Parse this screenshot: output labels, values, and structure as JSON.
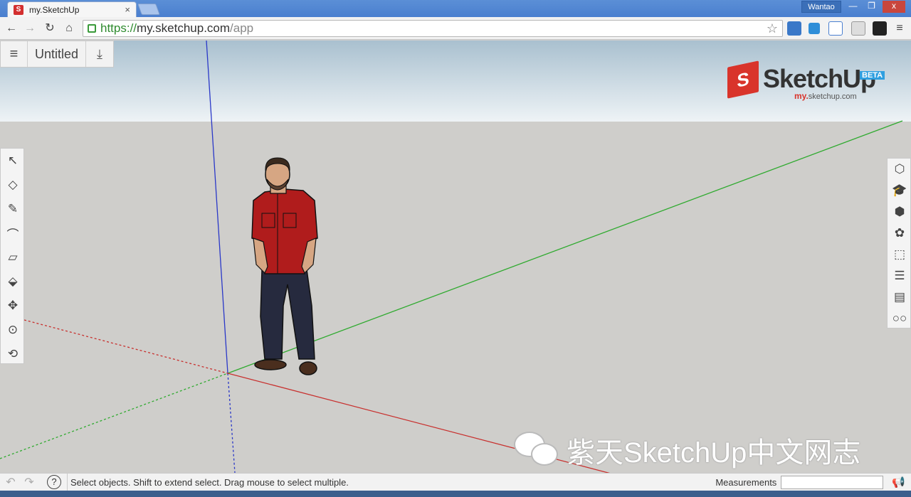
{
  "browser": {
    "tab_title": "my.SketchUp",
    "tab_close": "×",
    "user": "Wantao",
    "window_buttons": {
      "minimize": "—",
      "maximize": "❐",
      "close": "x"
    },
    "url_scheme": "https://",
    "url_host": "my.sketchup.com",
    "url_path": "/app",
    "nav": {
      "back": "←",
      "forward": "→",
      "reload": "↻",
      "home": "⌂"
    },
    "star": "☆",
    "menu": "≡"
  },
  "app": {
    "menu_icon": "≡",
    "document_title": "Untitled",
    "save_icon": "⤓"
  },
  "logo": {
    "name": "SketchUp",
    "badge": "BETA",
    "sub_prefix": "my.",
    "sub_domain": "sketchup.com"
  },
  "left_tools": [
    "↖",
    "◇",
    "✎",
    "⌒",
    "▱",
    "⬙",
    "✥",
    "⊙",
    "⟲"
  ],
  "right_tools": [
    "⬡",
    "🎓",
    "⬢",
    "✿",
    "⬚",
    "☰",
    "▤",
    "○○"
  ],
  "watermark": "紫天SketchUp中文网志",
  "status": {
    "undo": "↶",
    "redo": "↷",
    "help": "?",
    "message": "Select objects. Shift to extend select. Drag mouse to select multiple.",
    "measurements_label": "Measurements",
    "megaphone": "📢"
  },
  "colors": {
    "axis_red": "#c8302e",
    "axis_green": "#2faa2f",
    "axis_blue": "#2a38c8",
    "shirt": "#b01c1c",
    "jeans": "#262a3e"
  }
}
